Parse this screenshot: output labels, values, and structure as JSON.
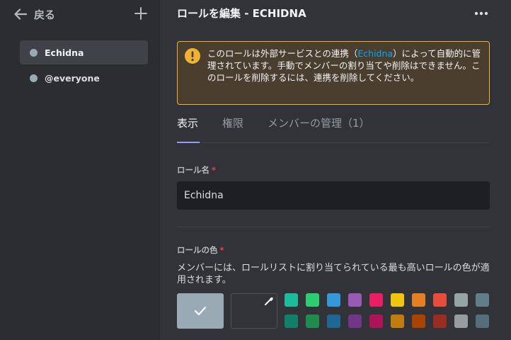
{
  "sidebar": {
    "back_label": "戻る",
    "roles": [
      {
        "name": "Echidna",
        "selected": true
      },
      {
        "name": "@everyone",
        "selected": false
      }
    ]
  },
  "header": {
    "title": "ロールを編集 - ECHIDNA"
  },
  "warning": {
    "text_before": "このロールは外部サービスとの連携（",
    "link": "Echidna",
    "text_after": "）によって自動的に管理されています。手動でメンバーの割り当てや削除はできません。このロールを削除するには、連携を削除してください。"
  },
  "tabs": [
    {
      "label": "表示",
      "active": true
    },
    {
      "label": "権限",
      "active": false
    },
    {
      "label": "メンバーの管理（1）",
      "active": false
    }
  ],
  "role_name": {
    "label": "ロール名",
    "required_mark": "*",
    "value": "Echidna"
  },
  "role_color": {
    "label": "ロールの色",
    "required_mark": "*",
    "description": "メンバーには、ロールリストに割り当てられている最も高いロールの色が適用されます。",
    "default_color": "#99aab5",
    "swatches_row1": [
      "#1abc9c",
      "#2ecc71",
      "#3498db",
      "#9b59b6",
      "#e91e63",
      "#f1c40f",
      "#e67e22",
      "#e74c3c",
      "#95a5a6",
      "#607d8b"
    ],
    "swatches_row2": [
      "#11806a",
      "#1f8b4c",
      "#206694",
      "#71368a",
      "#ad1457",
      "#c27c0e",
      "#a84300",
      "#992d22",
      "#979c9f",
      "#546e7a"
    ]
  }
}
